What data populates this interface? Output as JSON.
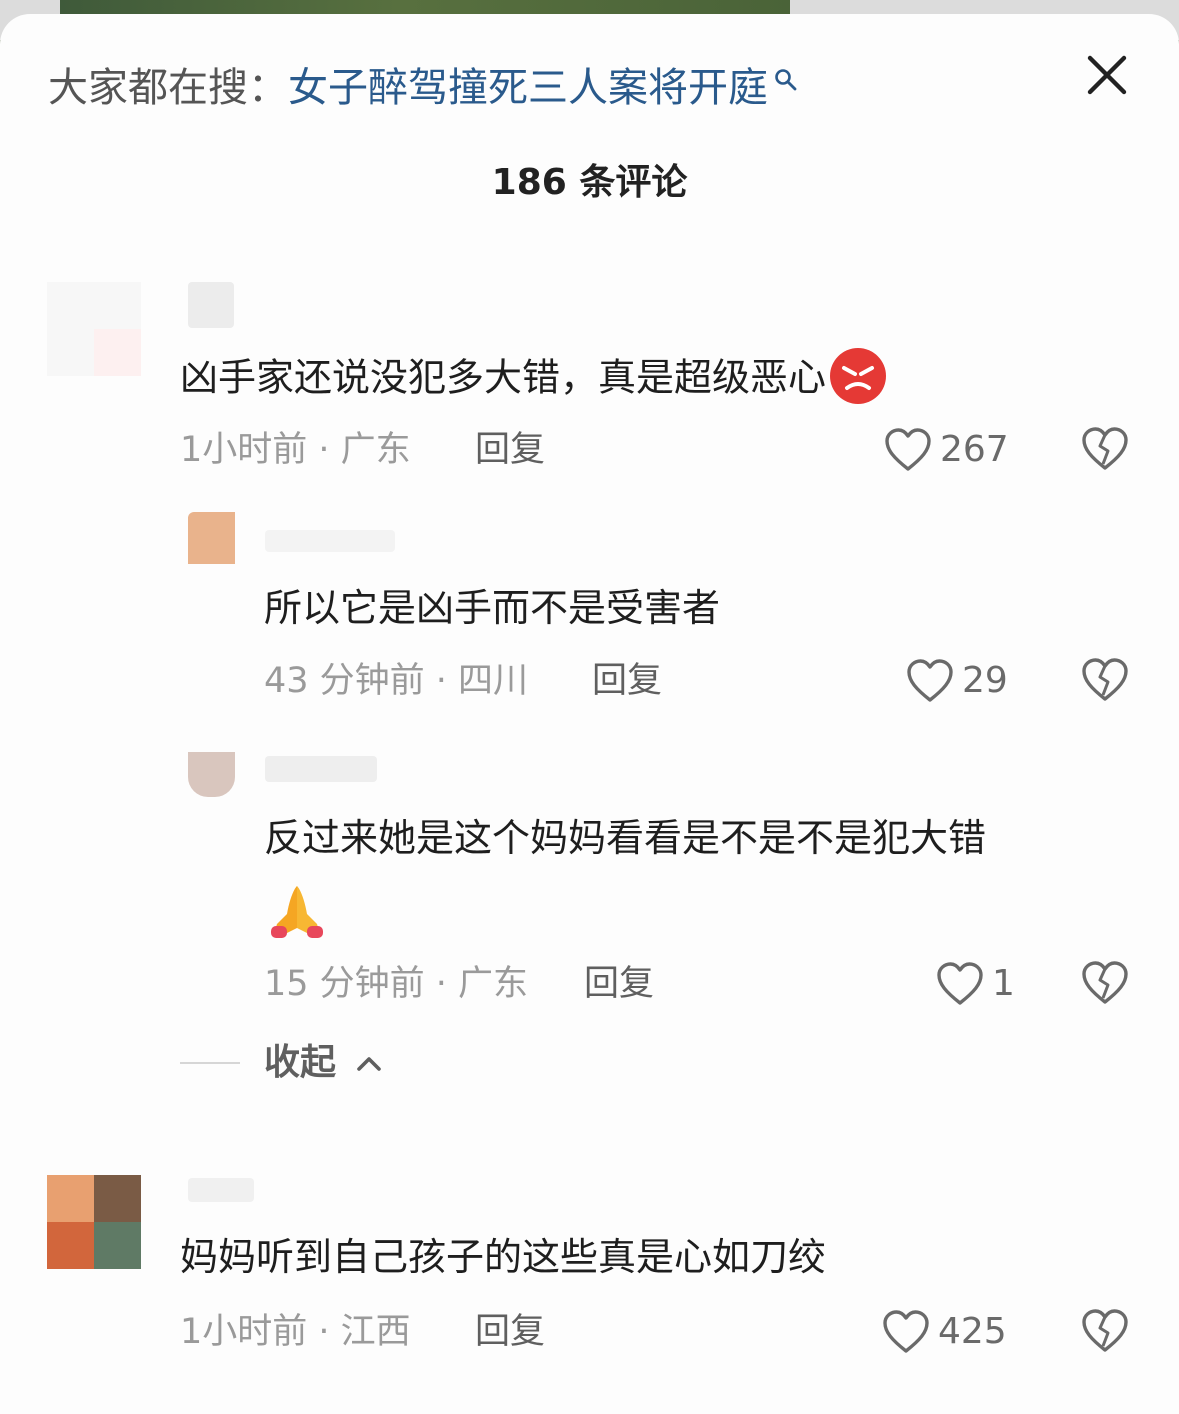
{
  "header": {
    "search_prefix": "大家都在搜：",
    "search_term": "女子醉驾撞死三人案将开庭",
    "comment_count_title": "186 条评论"
  },
  "comments": [
    {
      "text": "凶手家还说没犯多大错，真是超级恶心",
      "emoji": "angry-face",
      "time_location": "1小时前 · 广东",
      "reply_label": "回复",
      "likes": "267"
    },
    {
      "text": "所以它是凶手而不是受害者",
      "time_location": "43 分钟前 · 四川",
      "reply_label": "回复",
      "likes": "29"
    },
    {
      "text": "反过来她是这个妈妈看看是不是不是犯大错",
      "emoji": "folded-hands",
      "time_location": "15 分钟前 · 广东",
      "reply_label": "回复",
      "likes": "1"
    },
    {
      "text": "妈妈听到自己孩子的这些真是心如刀绞",
      "time_location": "1小时前 · 江西",
      "reply_label": "回复",
      "likes": "425"
    }
  ],
  "collapse_label": "收起",
  "icons": {
    "like": "heart-outline-icon",
    "dislike": "broken-heart-icon",
    "close": "close-icon",
    "search": "search-icon",
    "collapse": "chevron-up-icon"
  },
  "colors": {
    "search_term": "#2a5a8c",
    "angry_emoji": "#e53935",
    "folded_hands": "#f5a623"
  }
}
